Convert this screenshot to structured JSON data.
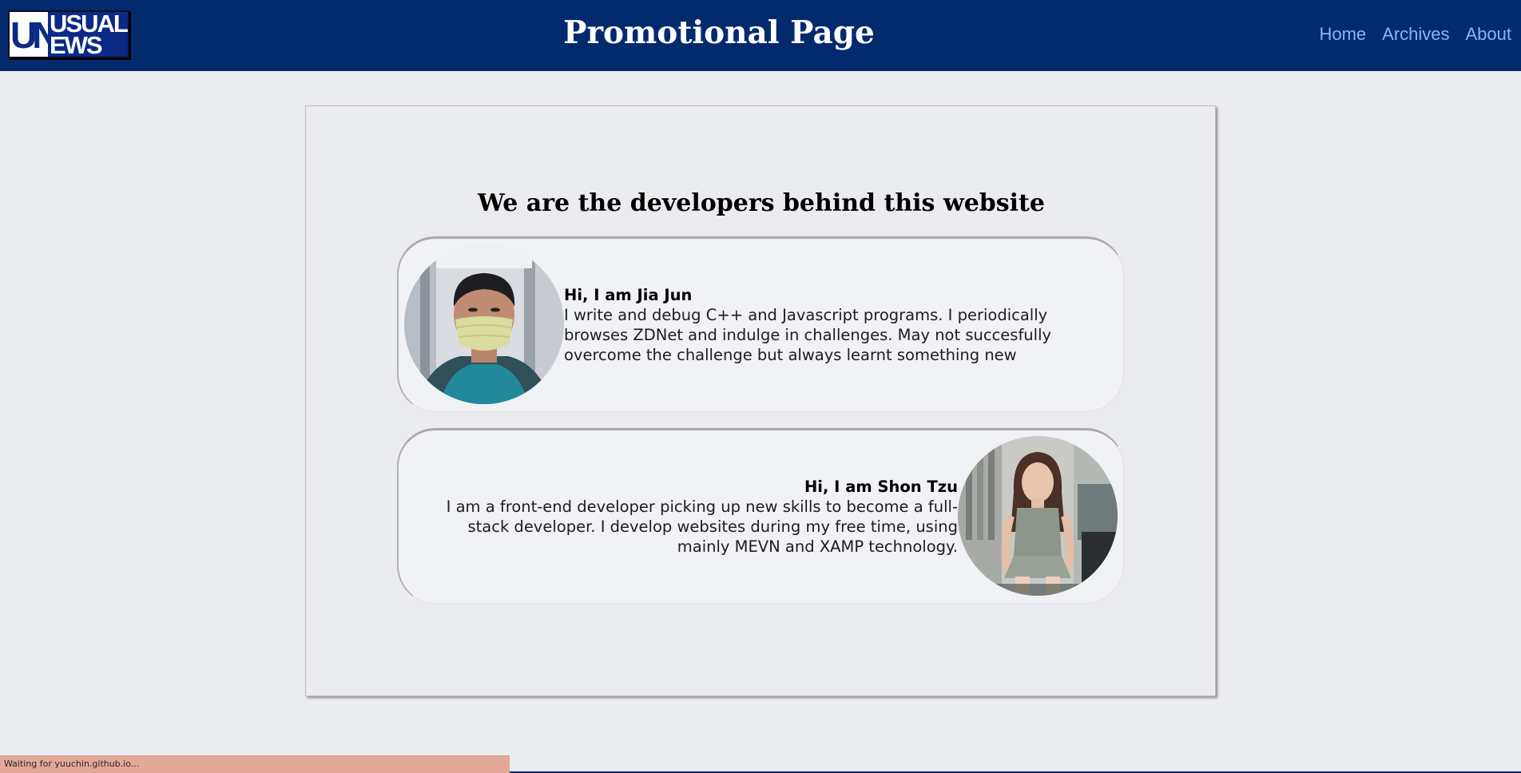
{
  "header": {
    "logo": {
      "un": "UN",
      "usual": "USUAL",
      "ews": "EWS"
    },
    "title": "Promotional Page",
    "nav": [
      "Home",
      "Archives",
      "About"
    ]
  },
  "main": {
    "heading": "We are the developers behind this website",
    "developers": [
      {
        "name": "Hi, I am Jia Jun",
        "bio": "I write and debug C++ and Javascript programs. I periodically browses ZDNet and indulge in challenges. May not succesfully overcome the challenge but always learnt something new",
        "photo": "masked-man-photo"
      },
      {
        "name": "Hi, I am Shon Tzu",
        "bio": "I am a front-end developer picking up new skills to become a full-stack developer. I develop websites during my free time, using mainly MEVN and XAMP technology.",
        "photo": "seated-woman-photo"
      }
    ]
  },
  "status": "Waiting for yuuchin.github.io...",
  "colors": {
    "header_bg": "#042a6e",
    "nav_link": "#85b8ec",
    "page_bg": "#ebecf0",
    "card_bg": "#f1f2f6",
    "status_bg": "#e3a898"
  }
}
